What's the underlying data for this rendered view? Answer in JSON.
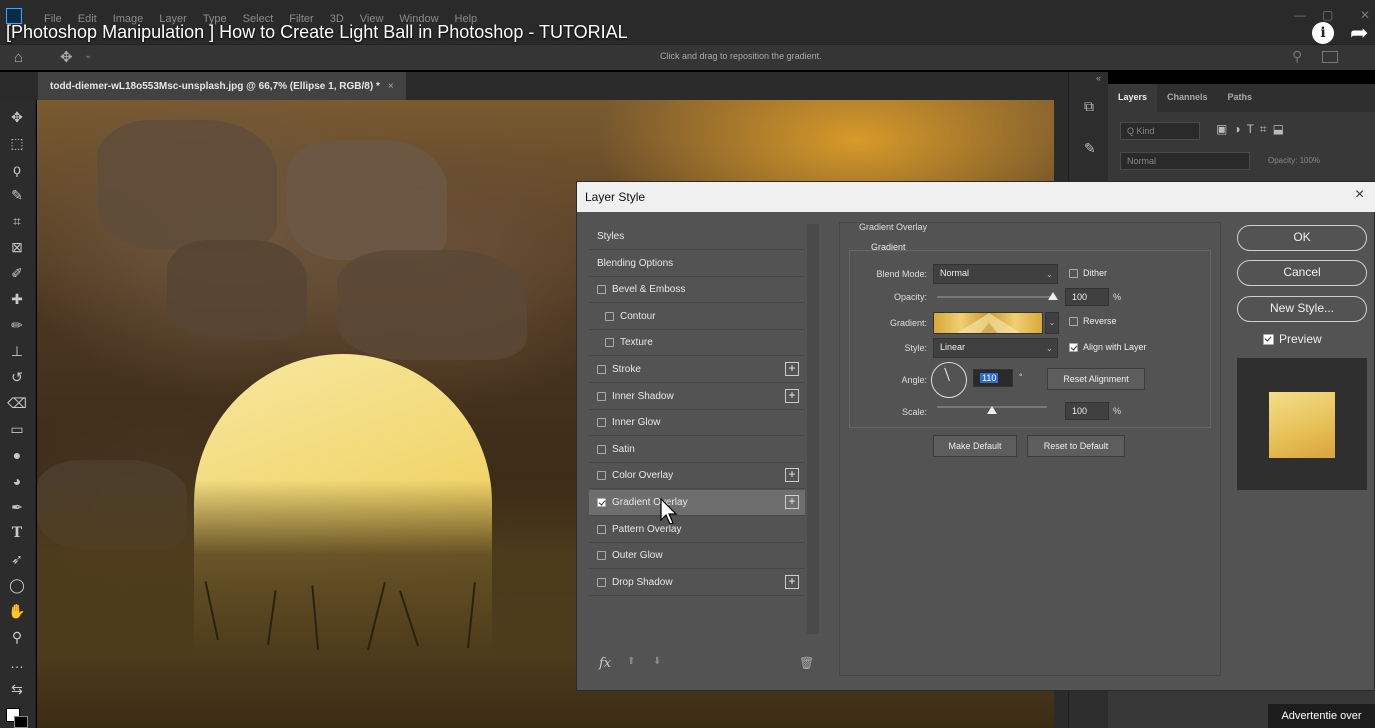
{
  "window": {
    "video_title": "[Photoshop Manipulation ] How to Create Light Ball in Photoshop - TUTORIAL",
    "menu": [
      "File",
      "Edit",
      "Image",
      "Layer",
      "Type",
      "Select",
      "Filter",
      "3D",
      "View",
      "Window",
      "Help"
    ],
    "hint": "Click and drag to reposition the gradient.",
    "info_glyph": "i"
  },
  "document": {
    "tab_label": "todd-diemer-wL18o553Msc-unsplash.jpg @ 66,7% (Ellipse 1, RGB/8) *",
    "tab_close": "×"
  },
  "layers_panel": {
    "tabs": [
      "Layers",
      "Channels",
      "Paths"
    ],
    "filter_placeholder": "Q Kind",
    "blend_mode": "Normal",
    "opacity_label": "Opacity: 100%"
  },
  "dialog": {
    "title": "Layer Style",
    "close": "×",
    "styles": [
      {
        "label": "Styles",
        "checkbox": false,
        "checked": false,
        "plus": false,
        "indent": false
      },
      {
        "label": "Blending Options",
        "checkbox": false,
        "checked": false,
        "plus": false,
        "indent": false
      },
      {
        "label": "Bevel & Emboss",
        "checkbox": true,
        "checked": false,
        "plus": false,
        "indent": false
      },
      {
        "label": "Contour",
        "checkbox": true,
        "checked": false,
        "plus": false,
        "indent": true
      },
      {
        "label": "Texture",
        "checkbox": true,
        "checked": false,
        "plus": false,
        "indent": true
      },
      {
        "label": "Stroke",
        "checkbox": true,
        "checked": false,
        "plus": true,
        "indent": false
      },
      {
        "label": "Inner Shadow",
        "checkbox": true,
        "checked": false,
        "plus": true,
        "indent": false
      },
      {
        "label": "Inner Glow",
        "checkbox": true,
        "checked": false,
        "plus": false,
        "indent": false
      },
      {
        "label": "Satin",
        "checkbox": true,
        "checked": false,
        "plus": false,
        "indent": false
      },
      {
        "label": "Color Overlay",
        "checkbox": true,
        "checked": false,
        "plus": true,
        "indent": false
      },
      {
        "label": "Gradient Overlay",
        "checkbox": true,
        "checked": true,
        "plus": true,
        "indent": false,
        "selected": true
      },
      {
        "label": "Pattern Overlay",
        "checkbox": true,
        "checked": false,
        "plus": false,
        "indent": false
      },
      {
        "label": "Outer Glow",
        "checkbox": true,
        "checked": false,
        "plus": false,
        "indent": false
      },
      {
        "label": "Drop Shadow",
        "checkbox": true,
        "checked": false,
        "plus": true,
        "indent": false
      }
    ],
    "fx_label": "fx",
    "section_title": "Gradient Overlay",
    "group_label": "Gradient",
    "blend_mode_label": "Blend Mode:",
    "blend_mode_value": "Normal",
    "dither_label": "Dither",
    "dither_checked": false,
    "opacity_label": "Opacity:",
    "opacity_value": "100",
    "opacity_unit": "%",
    "opacity_level": 1.0,
    "gradient_label": "Gradient:",
    "reverse_label": "Reverse",
    "reverse_checked": false,
    "style_label": "Style:",
    "style_value": "Linear",
    "align_label": "Align with Layer",
    "align_checked": true,
    "angle_label": "Angle:",
    "angle_value": "110",
    "angle_unit": "°",
    "reset_alignment": "Reset Alignment",
    "scale_label": "Scale:",
    "scale_value": "100",
    "scale_unit": "%",
    "scale_level": 0.5,
    "make_default": "Make Default",
    "reset_default": "Reset to Default",
    "ok": "OK",
    "cancel": "Cancel",
    "new_style": "New Style...",
    "preview_label": "Preview",
    "preview_checked": true
  },
  "ad": {
    "label": "Advertentie over"
  },
  "colors": {
    "ball_top": "#f7e8a0",
    "ball_bottom": "#e3b84a",
    "dialog_bg": "#535353",
    "selected_row": "#6e6e6e"
  }
}
